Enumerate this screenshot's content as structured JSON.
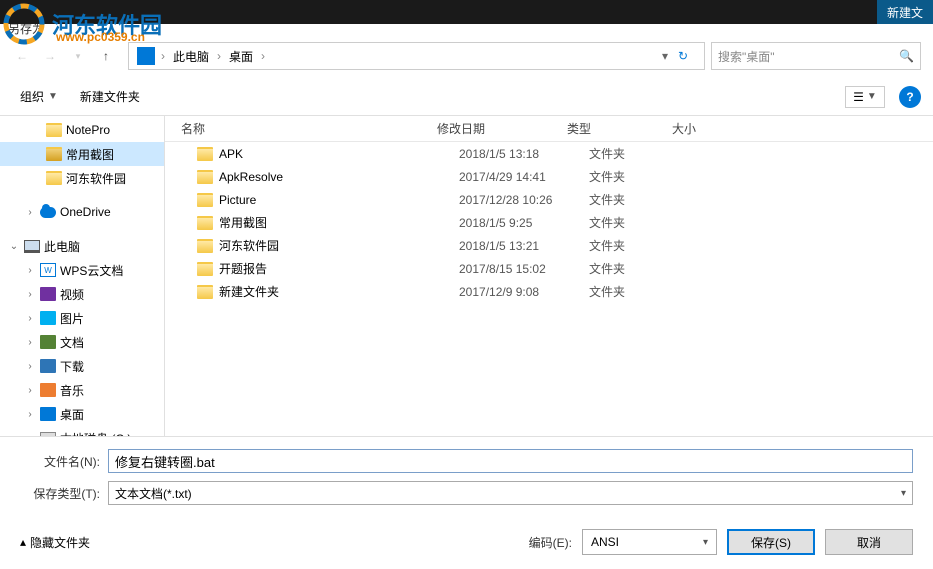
{
  "titlebar": {
    "newfile": "新建文"
  },
  "dialog_title": "另存为",
  "watermark": {
    "text": "河东软件园",
    "url": "www.pc0359.cn"
  },
  "breadcrumb": {
    "seg1": "此电脑",
    "seg2": "桌面"
  },
  "search": {
    "placeholder": "搜索\"桌面\""
  },
  "toolbar": {
    "organize": "组织",
    "newfolder": "新建文件夹"
  },
  "sidebar": {
    "items": [
      {
        "label": "NotePro"
      },
      {
        "label": "常用截图"
      },
      {
        "label": "河东软件园"
      },
      {
        "label": "OneDrive"
      },
      {
        "label": "此电脑"
      },
      {
        "label": "WPS云文档"
      },
      {
        "label": "视频"
      },
      {
        "label": "图片"
      },
      {
        "label": "文档"
      },
      {
        "label": "下载"
      },
      {
        "label": "音乐"
      },
      {
        "label": "桌面"
      },
      {
        "label": "本地磁盘 (C:)"
      }
    ]
  },
  "columns": {
    "name": "名称",
    "date": "修改日期",
    "type": "类型",
    "size": "大小"
  },
  "rows": [
    {
      "name": "APK",
      "date": "2018/1/5 13:18",
      "type": "文件夹"
    },
    {
      "name": "ApkResolve",
      "date": "2017/4/29 14:41",
      "type": "文件夹"
    },
    {
      "name": "Picture",
      "date": "2017/12/28 10:26",
      "type": "文件夹"
    },
    {
      "name": "常用截图",
      "date": "2018/1/5 9:25",
      "type": "文件夹"
    },
    {
      "name": "河东软件园",
      "date": "2018/1/5 13:21",
      "type": "文件夹"
    },
    {
      "name": "开题报告",
      "date": "2017/8/15 15:02",
      "type": "文件夹"
    },
    {
      "name": "新建文件夹",
      "date": "2017/12/9 9:08",
      "type": "文件夹"
    }
  ],
  "fields": {
    "filename_label": "文件名(N):",
    "filename_value": "修复右键转圈.bat",
    "savetype_label": "保存类型(T):",
    "savetype_value": "文本文档(*.txt)"
  },
  "footer": {
    "hide": "隐藏文件夹",
    "encoding_label": "编码(E):",
    "encoding_value": "ANSI",
    "save": "保存(S)",
    "cancel": "取消"
  }
}
